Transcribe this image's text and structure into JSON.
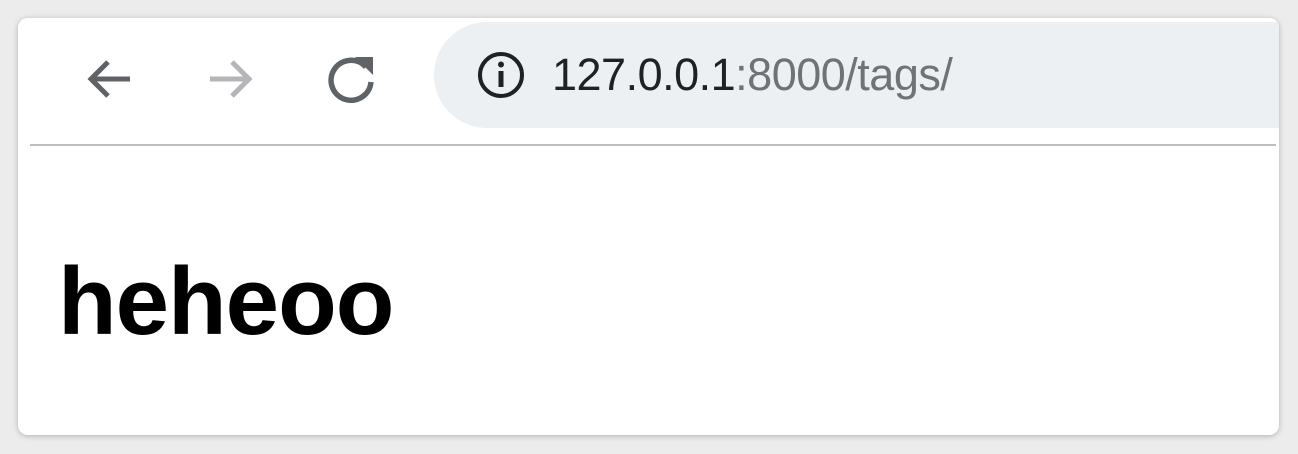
{
  "toolbar": {
    "back_icon": "arrow-left-icon",
    "forward_icon": "arrow-right-icon",
    "reload_icon": "reload-icon",
    "colors": {
      "active_icon": "#5f6368",
      "disabled_icon": "#b3b5b8",
      "omnibox_bg": "#edf0f2"
    }
  },
  "address_bar": {
    "security_icon": "info-icon",
    "url_host": "127.0.0.1",
    "url_rest": ":8000/tags/"
  },
  "page": {
    "heading": "heheoo"
  }
}
